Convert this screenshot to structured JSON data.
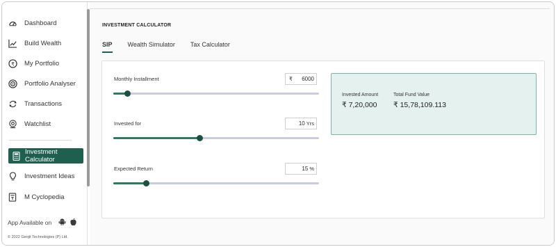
{
  "sidebar": {
    "items": [
      {
        "label": "Dashboard",
        "icon": "dashboard-icon"
      },
      {
        "label": "Build Wealth",
        "icon": "chart-line-icon"
      },
      {
        "label": "My Portfolio",
        "icon": "rupee-coin-icon"
      },
      {
        "label": "Portfolio Analyser",
        "icon": "target-icon"
      },
      {
        "label": "Transactions",
        "icon": "refresh-icon"
      },
      {
        "label": "Watchlist",
        "icon": "eye-icon"
      },
      {
        "label": "Investment Calculator",
        "icon": "calculator-icon",
        "active": true
      },
      {
        "label": "Investment Ideas",
        "icon": "lightbulb-icon"
      },
      {
        "label": "M Cyclopedia",
        "icon": "book-icon"
      }
    ],
    "app_available": "\u0000pp Available on",
    "copyright": "© 2022 Geojit Technologies (P) Ltd."
  },
  "main": {
    "title": "INVESTMENT CALCULATOR",
    "tabs": [
      {
        "label": "SIP",
        "active": true
      },
      {
        "label": "Wealth Simulator",
        "active": false
      },
      {
        "label": "Tax Calculator",
        "active": false
      }
    ],
    "fields": {
      "monthly": {
        "label": "Monthly Installment",
        "currency": "₹",
        "value": "6000",
        "slider_fraction": 0.07
      },
      "period": {
        "label": "Invested for",
        "value": "10",
        "unit": "Yrs",
        "slider_fraction": 0.42
      },
      "return": {
        "label": "Expected Return",
        "value": "15",
        "unit": "%",
        "slider_fraction": 0.16
      }
    },
    "results": {
      "invested_label": "Invested Amount",
      "invested_value": "₹ 7,20,000",
      "total_label": "Total Fund Value",
      "total_value": "₹ 15,78,109.113"
    }
  },
  "colors": {
    "accent": "#1f5f4f",
    "slider_fill": "#2e7a5f",
    "slider_track": "#c9cce0",
    "result_bg": "#e4f1ee",
    "result_border": "#7fb3a6"
  }
}
